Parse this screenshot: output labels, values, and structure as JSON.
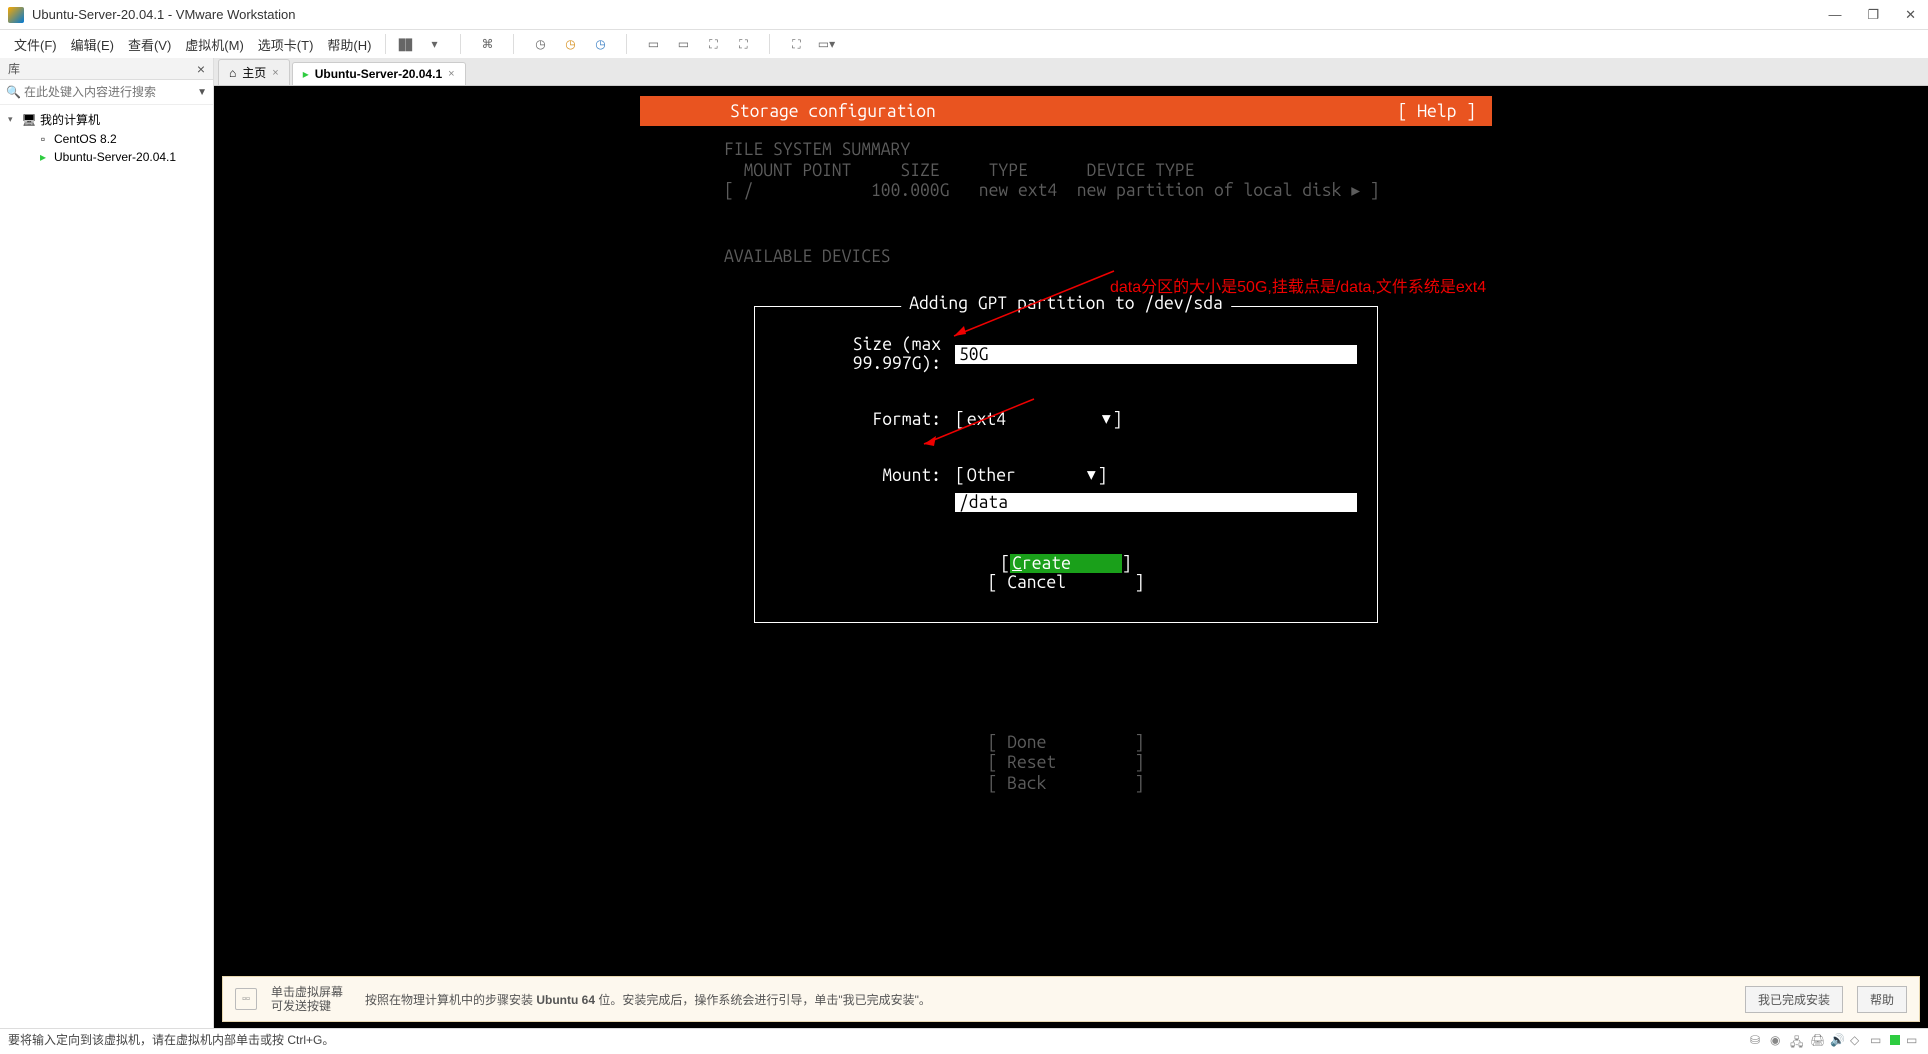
{
  "window": {
    "title": "Ubuntu-Server-20.04.1 - VMware Workstation"
  },
  "menu": {
    "items": [
      "文件(F)",
      "编辑(E)",
      "查看(V)",
      "虚拟机(M)",
      "选项卡(T)",
      "帮助(H)"
    ]
  },
  "sidebar": {
    "header": "库",
    "search_placeholder": "在此处键入内容进行搜索",
    "root": "我的计算机",
    "children": [
      "CentOS 8.2",
      "Ubuntu-Server-20.04.1"
    ]
  },
  "tabs": {
    "home": "主页",
    "active": "Ubuntu-Server-20.04.1"
  },
  "installer": {
    "header_title": "Storage configuration",
    "header_help": "[ Help ]",
    "summary_title": "FILE SYSTEM SUMMARY",
    "fs_cols": "  MOUNT POINT     SIZE     TYPE      DEVICE TYPE",
    "fs_row": "[ /            100.000G   new ext4  new partition of local disk ▸ ]",
    "avail_title": "AVAILABLE DEVICES",
    "dialog_title": "Adding GPT partition to /dev/sda",
    "size_label": "Size (max 99.997G):",
    "size_value": "50G",
    "format_label": "Format:",
    "format_value": "ext4",
    "mount_label": "Mount:",
    "mount_select": "Other",
    "mount_value": "/data",
    "create_label": "Create",
    "cancel_label": "Cancel",
    "bottom": {
      "done": "Done",
      "reset": "Reset",
      "back": "Back"
    }
  },
  "annotation": {
    "text": "data分区的大小是50G,挂载点是/data,文件系统是ext4"
  },
  "hintbar": {
    "text1": "单击虚拟屏幕可发送按键",
    "main_pre": "按照在物理计算机中的步骤安装 ",
    "main_bold": "Ubuntu 64",
    "main_post": " 位。安装完成后，操作系统会进行引导，单击\"我已完成安装\"。",
    "btn1": "我已完成安装",
    "btn2": "帮助"
  },
  "statusbar": {
    "text": "要将输入定向到该虚拟机，请在虚拟机内部单击或按 Ctrl+G。"
  }
}
